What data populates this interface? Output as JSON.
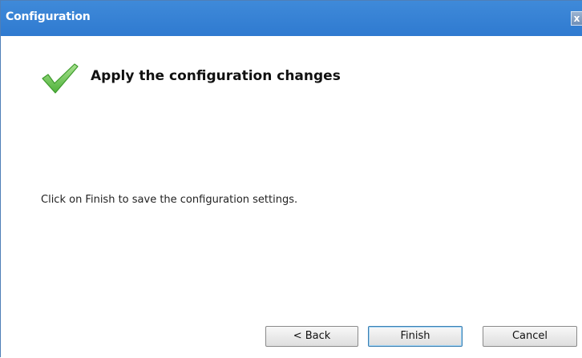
{
  "window": {
    "title": "Configuration",
    "close_glyph": "x"
  },
  "main": {
    "icon": "check-icon",
    "heading": "Apply the configuration changes",
    "instruction": "Click on Finish to save the configuration settings."
  },
  "buttons": {
    "back_label": "< Back",
    "finish_label": "Finish",
    "cancel_label": "Cancel"
  },
  "colors": {
    "titlebar": "#2f7ad0",
    "check": "#5cc24a"
  }
}
